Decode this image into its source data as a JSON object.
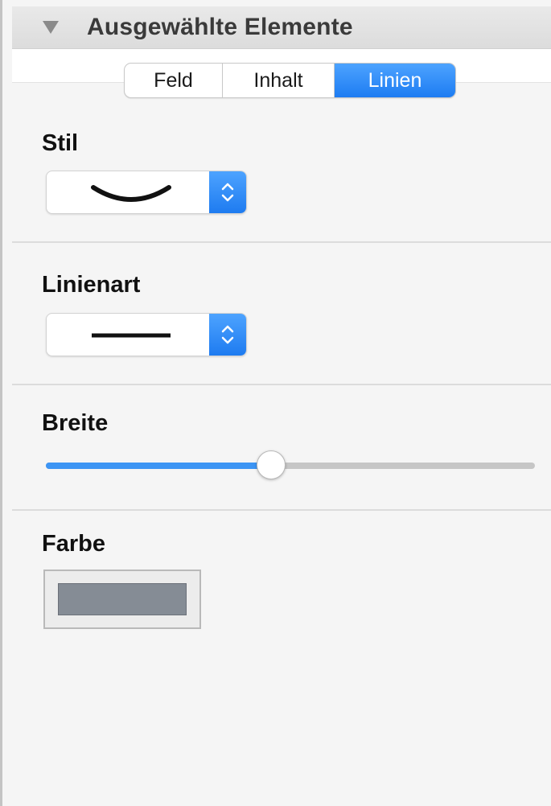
{
  "header": {
    "title": "Ausgewählte Elemente",
    "disclosure_icon": "triangle-down-icon"
  },
  "tabs": [
    {
      "label": "Feld",
      "selected": false
    },
    {
      "label": "Inhalt",
      "selected": false
    },
    {
      "label": "Linien",
      "selected": true
    }
  ],
  "stil": {
    "label": "Stil",
    "value_icon": "curved-line-icon"
  },
  "linienart": {
    "label": "Linienart",
    "value_icon": "solid-line-icon"
  },
  "breite": {
    "label": "Breite",
    "level": 0.46
  },
  "farbe": {
    "label": "Farbe",
    "color": "#858c95"
  },
  "colors": {
    "accent": "#1d7cf2"
  }
}
